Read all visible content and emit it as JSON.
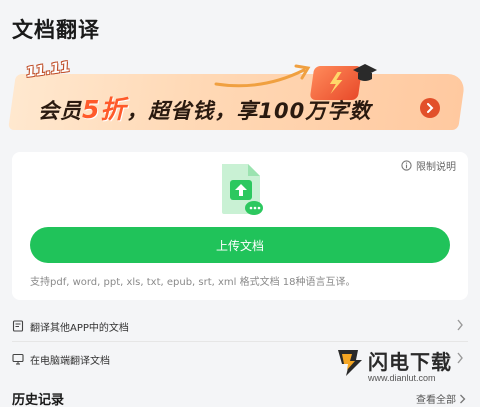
{
  "header": {
    "title": "文档翻译"
  },
  "banner": {
    "badge": "11.11",
    "text_part1": "会员",
    "text_highlight": "5折",
    "text_part2": "，超省钱，享100万字数",
    "colors": {
      "bg": "#ffd9b6",
      "accent": "#ff5a2a"
    }
  },
  "upload": {
    "limit_label": "限制说明",
    "button_label": "上传文档",
    "formats_text": "支持pdf, word, ppt, xls, txt, epub, srt, xml 格式文档 18种语言互译。",
    "colors": {
      "button": "#20c35a"
    }
  },
  "list": {
    "items": [
      {
        "label": "翻译其他APP中的文档",
        "icon": "document-icon"
      },
      {
        "label": "在电脑端翻译文档",
        "icon": "monitor-icon"
      }
    ]
  },
  "history": {
    "title": "历史记录",
    "view_all": "查看全部"
  },
  "watermark": {
    "title": "闪电下载",
    "url": "www.dianlut.com"
  }
}
